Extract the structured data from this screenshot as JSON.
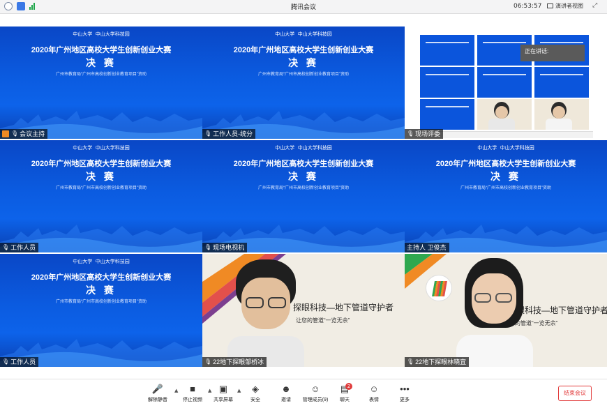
{
  "window": {
    "title": "腾讯会议",
    "time": "06:53:57",
    "presenter_view_label": "演讲者视图"
  },
  "slide": {
    "logo_left": "中山大学",
    "logo_right": "中山大学科技园",
    "headline": "2020年广州地区高校大学生创新创业大赛",
    "final": "决 赛",
    "sub": "广州市教育局“广州市高校创新创业教育项目”资助"
  },
  "tiles": [
    {
      "name": "会议主持"
    },
    {
      "name": "工作人员-统分"
    },
    {
      "name": "现场评委"
    },
    {
      "name": "工作人员"
    },
    {
      "name": "现场电视机"
    },
    {
      "name": "主持人 卫俊杰"
    },
    {
      "name": "工作人员"
    },
    {
      "name": "22地下探眼邹桥冰"
    },
    {
      "name": "22地下探眼林晓宜"
    }
  ],
  "poster": {
    "title_a": "探眼科技—地下管道守护者",
    "sub_a": "让您的管道“一览无余”",
    "title_b": "眼科技—地下管道守护者",
    "sub_b": "的管道“一览无余”"
  },
  "speaking_label": "正在讲话:",
  "toolbar": {
    "unmute": "解除静音",
    "stop_video": "停止视频",
    "share": "共享屏幕",
    "security": "安全",
    "invite": "邀请",
    "members": "管理成员(9)",
    "chat": "聊天",
    "chat_badge": "2",
    "apps": "表情",
    "more": "更多",
    "end": "结束会议"
  },
  "colors": {
    "slide_blue": "#0b5be0",
    "end_red": "#e23b3b",
    "host_orange": "#f08a24"
  }
}
